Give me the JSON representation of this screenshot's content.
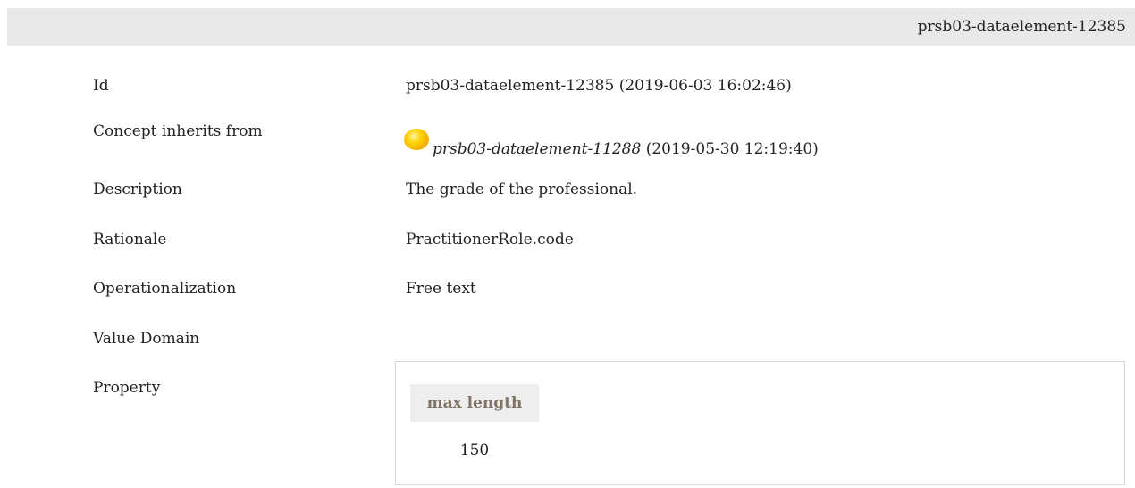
{
  "header": {
    "title": "prsb03-dataelement-12385"
  },
  "fields": {
    "id": {
      "label": "Id",
      "value": "prsb03-dataelement-12385 (2019-06-03 16:02:46)"
    },
    "inherits": {
      "label": "Concept inherits from",
      "icon": "status-orb-icon",
      "icon_color": "#f5b800",
      "ref": "prsb03-dataelement-11288",
      "date": " (2019-05-30 12:19:40)"
    },
    "description": {
      "label": "Description",
      "value": "The grade of the professional."
    },
    "rationale": {
      "label": "Rationale",
      "value": "PractitionerRole.code"
    },
    "operationalization": {
      "label": "Operationalization",
      "value": "Free text"
    },
    "value_domain": {
      "label": "Value Domain"
    },
    "property": {
      "label": "Property",
      "table": {
        "column_header": "max length",
        "value": "150"
      }
    }
  },
  "colors": {
    "header_bg": "#e9e9e9",
    "property_header_bg": "#eeeeee",
    "property_header_text": "#7f7466",
    "border": "#d6d6d6"
  }
}
